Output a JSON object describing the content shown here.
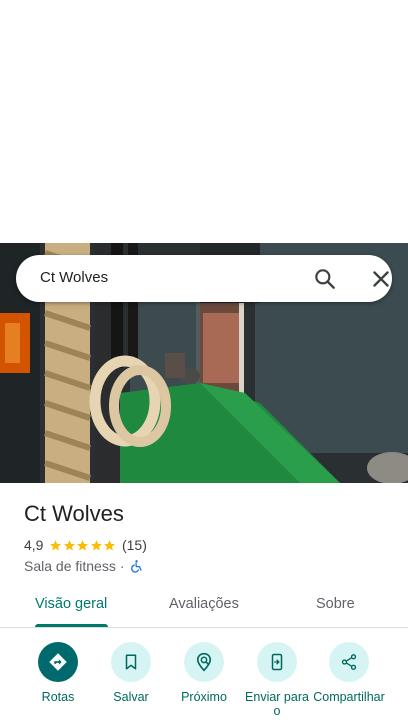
{
  "search": {
    "query": "Ct Wolves"
  },
  "place": {
    "name": "Ct Wolves",
    "rating": "4,9",
    "stars": 5,
    "review_count": "(15)",
    "category": "Sala de fitness",
    "separator": "·"
  },
  "tabs": [
    {
      "label": "Visão geral",
      "active": true
    },
    {
      "label": "Avaliações",
      "active": false
    },
    {
      "label": "Sobre",
      "active": false
    }
  ],
  "actions": [
    {
      "label": "Rotas",
      "icon": "directions-icon"
    },
    {
      "label": "Salvar",
      "icon": "bookmark-icon"
    },
    {
      "label": "Próximo",
      "icon": "nearby-icon"
    },
    {
      "label": "Enviar para o",
      "icon": "send-to-phone-icon"
    },
    {
      "label": "Compartilhar",
      "icon": "share-icon"
    }
  ],
  "colors": {
    "accent": "#00796b",
    "primary_button": "#00696e",
    "secondary_button_bg": "#d6f4f3",
    "star": "#fbbc04",
    "accessibility": "#1a73e8"
  }
}
